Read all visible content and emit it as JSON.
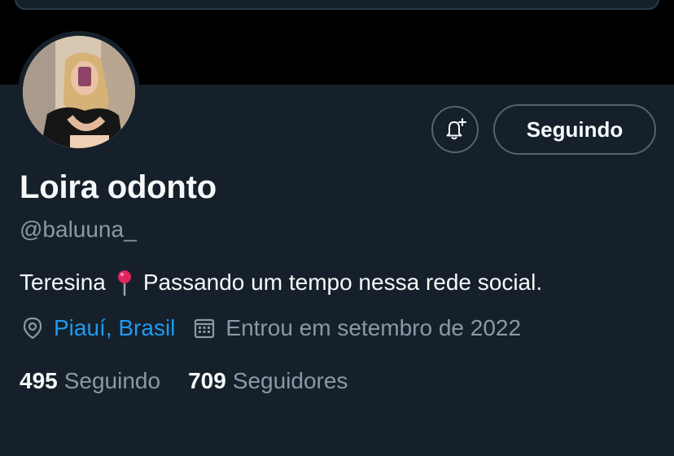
{
  "profile": {
    "name": "Loira odonto",
    "handle": "@baluuna_",
    "bio_city": "Teresina",
    "bio_emoji": "pin-emoji",
    "bio_text": "Passando um tempo nessa rede social.",
    "location": "Piauí, Brasil",
    "joined": "Entrou em setembro de 2022"
  },
  "actions": {
    "notify_icon": "bell-plus-icon",
    "following_label": "Seguindo"
  },
  "stats": {
    "following_count": "495",
    "following_label": "Seguindo",
    "followers_count": "709",
    "followers_label": "Seguidores"
  },
  "colors": {
    "background": "#15202b",
    "banner": "#000000",
    "accent": "#1d9bf0",
    "muted": "#8b98a5",
    "text": "#f7f9f9"
  }
}
